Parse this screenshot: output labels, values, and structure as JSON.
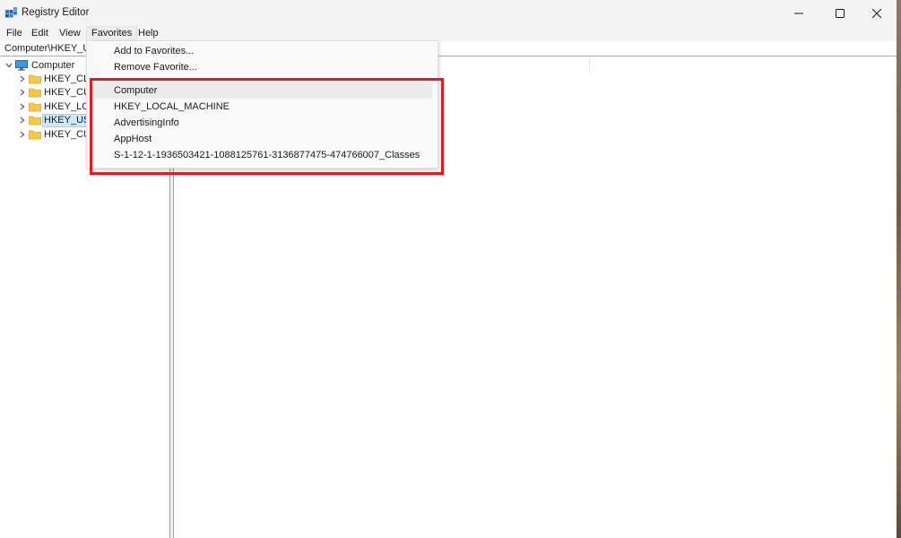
{
  "window": {
    "title": "Registry Editor"
  },
  "menu": {
    "items": [
      "File",
      "Edit",
      "View",
      "Favorites",
      "Help"
    ],
    "active": "Favorites"
  },
  "address": {
    "path": "Computer\\HKEY_US"
  },
  "tree": {
    "root_label": "Computer",
    "items": [
      {
        "label": "HKEY_CLA",
        "selected": false
      },
      {
        "label": "HKEY_CUR",
        "selected": false
      },
      {
        "label": "HKEY_LOC",
        "selected": false
      },
      {
        "label": "HKEY_USE",
        "selected": true
      },
      {
        "label": "HKEY_CUR",
        "selected": false
      }
    ]
  },
  "favorites_menu": {
    "actions": [
      "Add to Favorites...",
      "Remove Favorite..."
    ],
    "favorites": [
      "Computer",
      "HKEY_LOCAL_MACHINE",
      "AdvertisingInfo",
      "AppHost",
      "S-1-12-1-1936503421-1088125761-3136877475-474766007_Classes"
    ],
    "hovered": "Computer"
  },
  "colors": {
    "highlight_box": "#e01b24",
    "selection_bg": "#cce8ff",
    "folder": "#f5c84c"
  },
  "icons": {
    "app": "registry-editor-icon",
    "root": "computer-monitor-icon",
    "hive": "folder-icon"
  }
}
